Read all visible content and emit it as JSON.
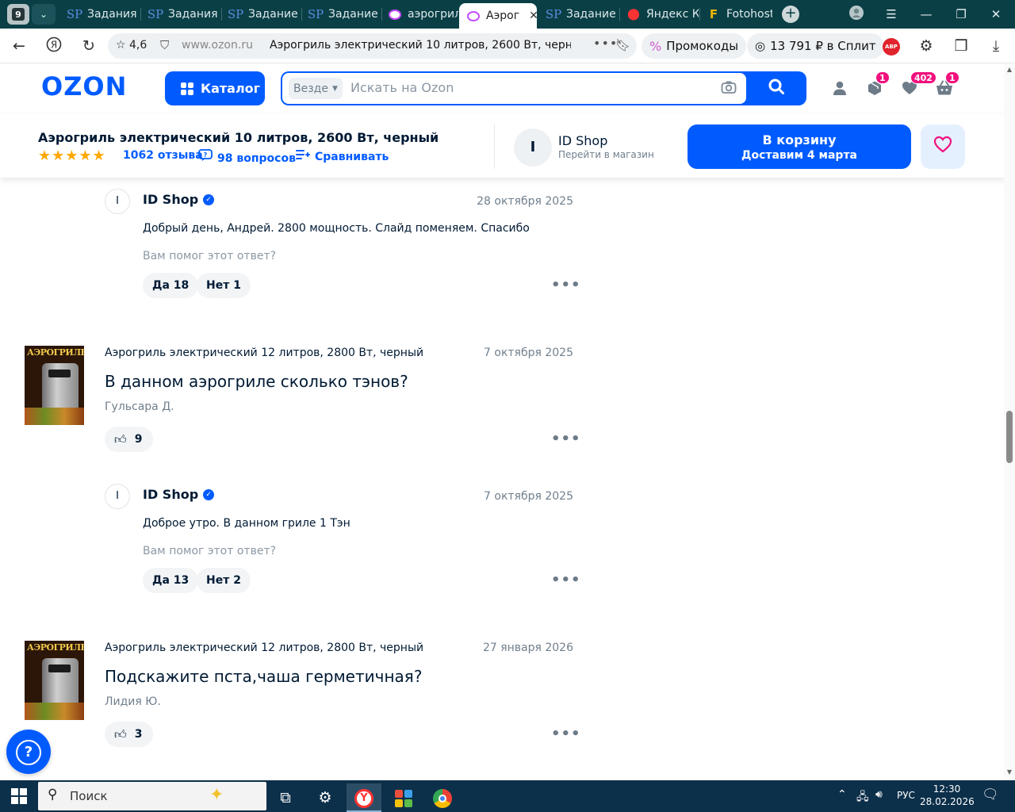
{
  "browser": {
    "tab_count": "9",
    "tabs": [
      {
        "label": "Задания",
        "icon": "sp-icon"
      },
      {
        "label": "Задания",
        "icon": "sp-icon"
      },
      {
        "label": "Задание",
        "icon": "sp-icon"
      },
      {
        "label": "Задание",
        "icon": "sp-icon"
      },
      {
        "label": "аэрогрил",
        "icon": "ozon-icon"
      },
      {
        "label": "Аэрог",
        "icon": "ozon-icon",
        "active": true
      },
      {
        "label": "Задание",
        "icon": "sp-icon"
      },
      {
        "label": "Яндекс К",
        "icon": "yandex-maps-icon"
      },
      {
        "label": "Fotohosti",
        "icon": "fotohosting-icon"
      }
    ],
    "rating": "4,6",
    "host": "www.ozon.ru",
    "page_title": "Аэрогриль электрический 10 литров, 2600 Вт, черн...",
    "promo_label": "Промокоды",
    "split_label": "13 791 ₽ в Сплит",
    "abp_label": "ABP"
  },
  "ozon": {
    "logo": "OZON",
    "catalog_label": "Каталог",
    "search_scope": "Везде",
    "search_placeholder": "Искать на Ozon",
    "badges": {
      "orders": "1",
      "favorites": "402",
      "cart": "1"
    }
  },
  "product_bar": {
    "title": "Аэрогриль электрический 10 литров, 2600 Вт, черный",
    "stars": "★★★★★",
    "reviews": "1062 отзыва",
    "questions": "98 вопросов",
    "compare": "Сравнивать",
    "shop_initial": "I",
    "shop_name": "ID Shop",
    "shop_link": "Перейти в магазин",
    "cart_label": "В корзину",
    "cart_delivery": "Доставим 4 марта"
  },
  "qa": {
    "helpful_prompt": "Вам помог этот ответ?",
    "thumb_text": "АЭРОГРИЛЬ",
    "items": [
      {
        "answer": {
          "initial": "I",
          "author": "ID Shop",
          "date": "28 октября 2025",
          "text": "Добрый день, Андрей. 2800 мощность. Слайд поменяем. Спасибо",
          "yes": "Да 18",
          "no": "Нет 1"
        }
      },
      {
        "question": {
          "product": "Аэрогриль электрический 12 литров, 2800 Вт, черный",
          "date": "7 октября 2025",
          "title": "В данном аэрогриле сколько тэнов?",
          "author": "Гульсара Д.",
          "likes": "9"
        },
        "answer": {
          "initial": "I",
          "author": "ID Shop",
          "date": "7 октября 2025",
          "text": "Доброе утро. В данном гриле 1 Тэн",
          "yes": "Да 13",
          "no": "Нет 2"
        }
      },
      {
        "question": {
          "product": "Аэрогриль электрический 12 литров, 2800 Вт, черный",
          "date": "27 января 2026",
          "title": "Подскажите пста,чаша герметичная?",
          "author": "Лидия Ю.",
          "likes": "3"
        }
      }
    ]
  },
  "taskbar": {
    "search_label": "Поиск",
    "lang": "РУС",
    "time": "12:30",
    "date": "28.02.2026"
  },
  "colors": {
    "ozon_blue": "#005bff",
    "badge_pink": "#f1117e",
    "star_gold": "#ffa800",
    "tabbar": "#0a3f46"
  }
}
